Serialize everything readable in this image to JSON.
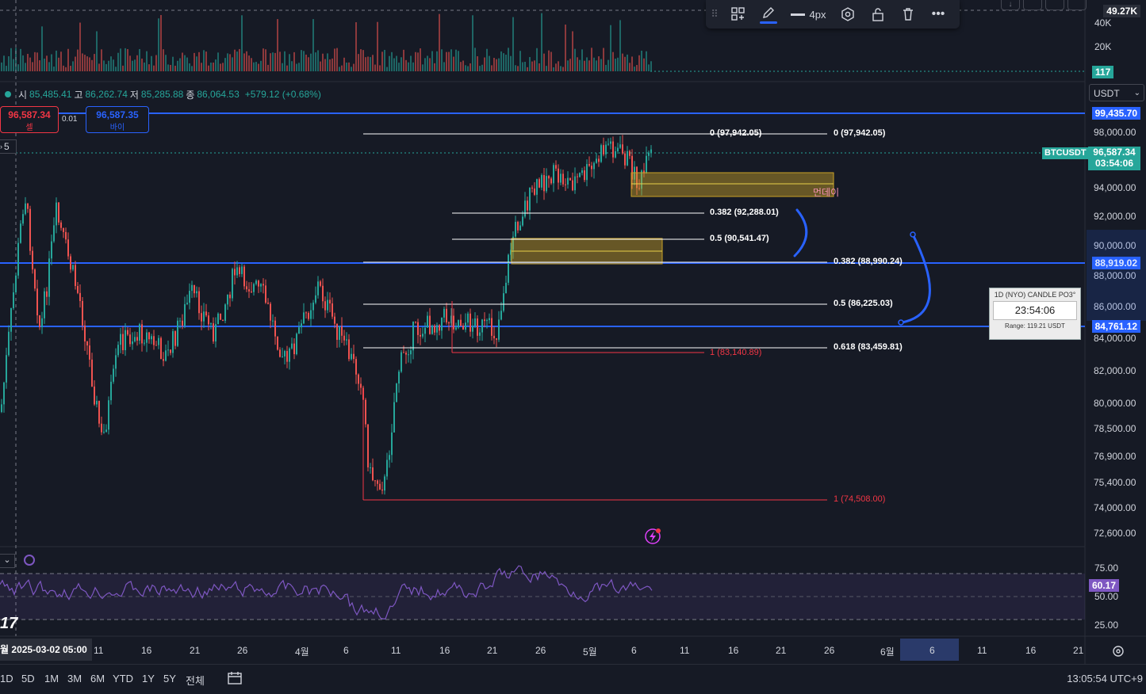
{
  "volume_pane": {
    "max_label": "49.27K",
    "ticks": [
      "40K",
      "20K"
    ],
    "current_volume": "117"
  },
  "ohlc": {
    "open_label": "시",
    "open": "85,485.41",
    "high_label": "고",
    "high": "86,262.74",
    "low_label": "저",
    "low": "85,285.88",
    "close_label": "종",
    "close": "86,064.53",
    "change": "+579.12 (+0.68%)"
  },
  "trade": {
    "sell_price": "96,587.34",
    "sell_label": "셀",
    "buy_price": "96,587.35",
    "buy_label": "바이",
    "spread": "0.01"
  },
  "layers_count": "5",
  "toolbar": {
    "width_label": "4px",
    "icons": [
      "drag-handle-icon",
      "templates-icon",
      "pencil-icon",
      "line-width-icon",
      "settings-icon",
      "lock-icon",
      "trash-icon",
      "more-icon"
    ],
    "accent": "#2962ff"
  },
  "currency": "USDT",
  "symbol": "BTCUSDT",
  "price_axis": {
    "ticks": [
      "98,000.00",
      "94,000.00",
      "92,000.00",
      "90,000.00",
      "88,000.00",
      "86,000.00",
      "84,000.00",
      "82,000.00",
      "80,000.00",
      "78,500.00",
      "76,900.00",
      "75,400.00",
      "74,000.00",
      "72,600.00"
    ],
    "hline_top": "99,435.70",
    "current_price": "96,587.34",
    "countdown": "03:54:06",
    "hline_mid": "88,919.02",
    "hline_low": "84,761.12"
  },
  "fib_set_a": {
    "level0": "0 (97,942.05)",
    "level382": "0.382 (92,288.01)",
    "level5": "0.5 (90,541.47)",
    "level1": "1 (83,140.89)"
  },
  "fib_set_b": {
    "level0": "0 (97,942.05)",
    "level382": "0.382 (88,990.24)",
    "level5": "0.5 (86,225.03)",
    "level618": "0.618 (83,459.81)",
    "level1": "1 (74,508.00)"
  },
  "zone_label": "먼데이",
  "candle_widget": {
    "title": "1D (NYO) CANDLE PO3°",
    "countdown": "23:54:06",
    "range": "Range: 119.21 USDT"
  },
  "rsi": {
    "ticks": [
      "75.00",
      "50.00",
      "25.00"
    ],
    "value": "60.17"
  },
  "time_axis": {
    "labels": [
      "11",
      "16",
      "21",
      "26",
      "4월",
      "6",
      "11",
      "16",
      "21",
      "26",
      "5월",
      "6",
      "11",
      "16",
      "21",
      "26",
      "6월",
      "6",
      "11",
      "16",
      "21"
    ],
    "crosshair": "2025-03-02  05:00",
    "left_cut": "월"
  },
  "ranges": [
    "1D",
    "5D",
    "1M",
    "3M",
    "6M",
    "YTD",
    "1Y",
    "5Y",
    "전체"
  ],
  "clock": "13:05:54 UTC+9",
  "colors": {
    "up": "#26a69a",
    "down": "#ef5350",
    "hline": "#2962ff",
    "rsi": "#7e57c2",
    "zone": "#c9a227",
    "fib_red": "#f23645"
  }
}
